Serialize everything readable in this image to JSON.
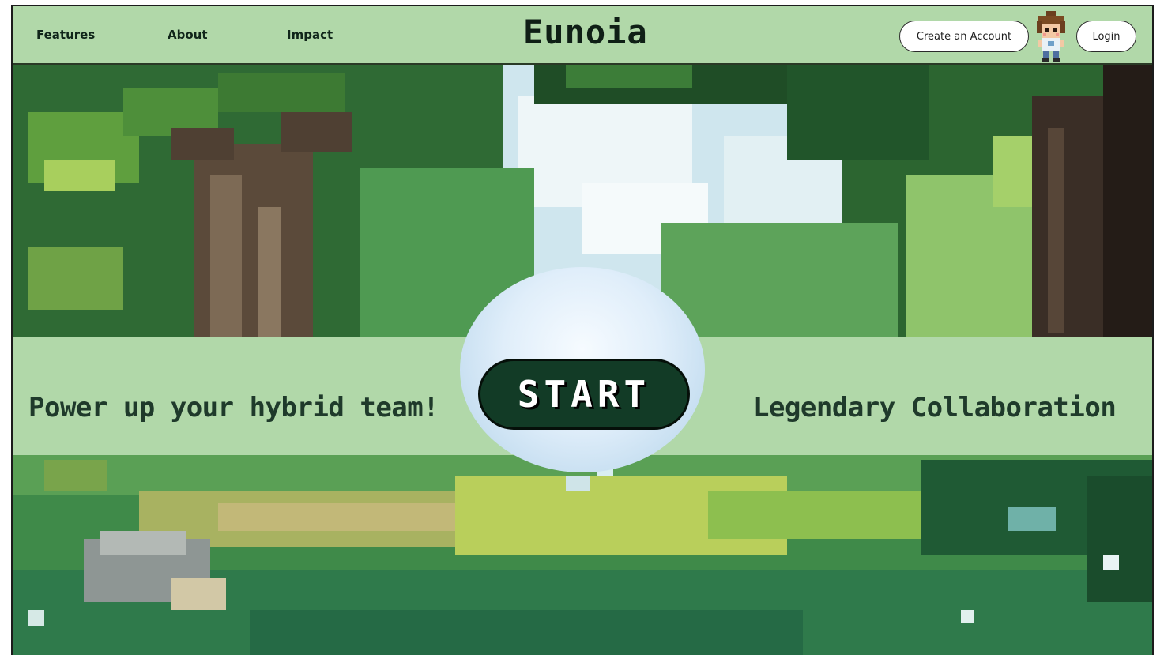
{
  "nav": {
    "links": [
      {
        "label": "Features"
      },
      {
        "label": "About"
      },
      {
        "label": "Impact"
      }
    ],
    "brand": "Eunoia",
    "create_account_label": "Create an Account",
    "login_label": "Login"
  },
  "hero": {
    "left_tagline": "Power up your hybrid team!",
    "right_tagline": "Legendary Collaboration",
    "start_label": "START"
  },
  "colors": {
    "nav_bg": "#b1d8a9",
    "banner_bg": "#b1d8a9",
    "start_bg": "#123b26",
    "text_dark": "#1f3a2b"
  },
  "icons": {
    "avatar": "pixel-avatar-icon",
    "background": "pixel-forest-scene"
  }
}
